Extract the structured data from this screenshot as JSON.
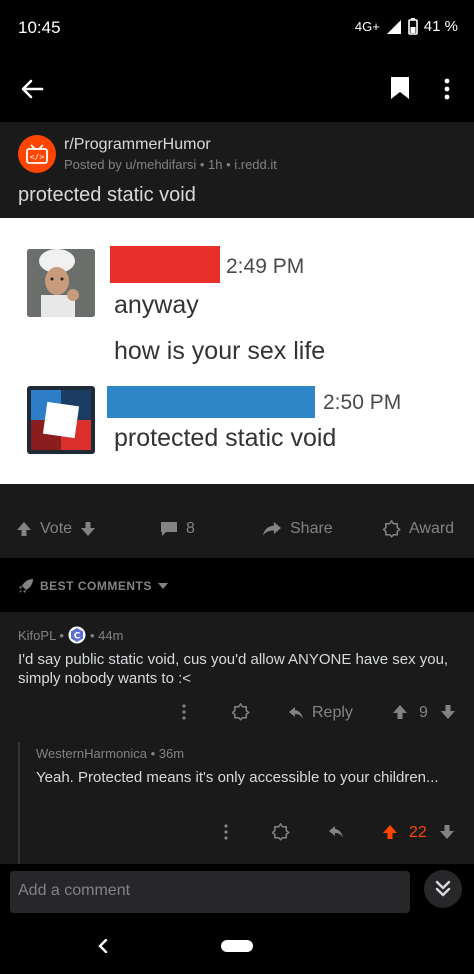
{
  "status": {
    "time": "10:45",
    "network": "4G+",
    "battery": "41 %"
  },
  "post": {
    "subreddit": "r/ProgrammerHumor",
    "meta": "Posted by u/mehdifarsi • 1h • i.redd.it",
    "title": "protected static void"
  },
  "meme": {
    "msg1_time": "2:49 PM",
    "msg1_line1": "anyway",
    "msg1_line2": "how is your sex life",
    "msg2_time": "2:50 PM",
    "msg2_line1": "protected static void"
  },
  "actions": {
    "vote": "Vote",
    "comments": "8",
    "share": "Share",
    "award": "Award"
  },
  "best_comments": "BEST COMMENTS",
  "comments": [
    {
      "author": "KifoPL •",
      "time": "• 44m",
      "text": "I'd say public static void, cus you'd allow ANYONE have sex you, simply nobody wants to :<",
      "reply": "Reply",
      "score": "9"
    },
    {
      "author": "WesternHarmonica • 36m",
      "text": "Yeah. Protected means it's only accessible to your children...",
      "score": "22"
    }
  ],
  "add_comment_placeholder": "Add a comment",
  "colors": {
    "upvote": "#ff4500",
    "bg": "#1a1a1b",
    "bar": "#000000"
  }
}
